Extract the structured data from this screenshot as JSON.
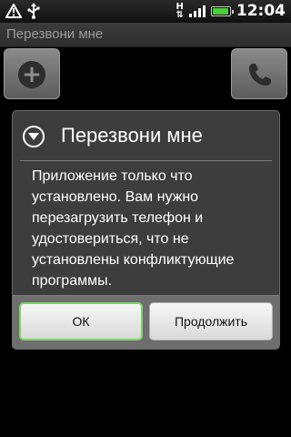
{
  "status_bar": {
    "time": "12:04",
    "icons": [
      "warning-icon",
      "usb-icon",
      "hspa-icon",
      "signal-icon",
      "battery-icon"
    ],
    "hspa_label": "H",
    "battery_level": 0.95,
    "battery_color": "#4dcc3c"
  },
  "title_bar": {
    "title": "Перезвони мне"
  },
  "background_buttons": {
    "add_icon": "plus-icon",
    "call_icon": "phone-icon"
  },
  "dialog": {
    "title": "Перезвони мне",
    "icon": "chevron-down-circle-icon",
    "message": "Приложение только что установлено. Вам нужно перезагрузить телефон и удостовериться, что не установлены конфликтующие программы.",
    "ok_label": "ОК",
    "continue_label": "Продолжить",
    "focus_color": "#7cd36b"
  }
}
